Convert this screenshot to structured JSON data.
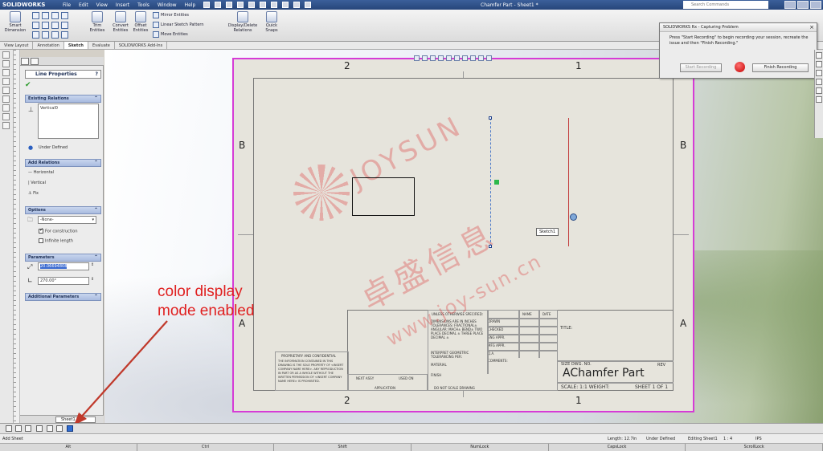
{
  "app": {
    "logo": "SOLIDWORKS",
    "menu": [
      "File",
      "Edit",
      "View",
      "Insert",
      "Tools",
      "Window",
      "Help"
    ],
    "doc_title": "Chamfer Part - Sheet1 *",
    "search_placeholder": "Search Commands"
  },
  "commands": {
    "smart_dimension": "Smart Dimension",
    "trim_entities": "Trim Entities",
    "convert_entities": "Convert Entities",
    "offset_entities": "Offset Entities",
    "mirror_entities": "Mirror Entities",
    "linear_sketch_pattern": "Linear Sketch Pattern",
    "move_entities": "Move Entities",
    "display_delete_relations": "Display/Delete Relations",
    "quick_snaps": "Quick Snaps"
  },
  "tabs": [
    {
      "label": "View Layout"
    },
    {
      "label": "Annotation"
    },
    {
      "label": "Sketch"
    },
    {
      "label": "Evaluate"
    },
    {
      "label": "SOLIDWORKS Add-Ins"
    }
  ],
  "property_manager": {
    "title": "Line Properties",
    "existing_relations": {
      "header": "Existing Relations",
      "item": "Vertical0",
      "status": "Under Defined"
    },
    "add_relations": {
      "header": "Add Relations",
      "items": [
        "Horizontal",
        "Vertical",
        "Fix"
      ]
    },
    "options": {
      "header": "Options",
      "dropdown_value": "-None-",
      "for_construction": "For construction",
      "infinite_length": "Infinite length"
    },
    "parameters": {
      "header": "Parameters",
      "length": "20.06694808",
      "angle": "270.00°"
    },
    "additional": {
      "header": "Additional Parameters"
    }
  },
  "sheet": {
    "zone_top": [
      "2",
      "1"
    ],
    "zone_bottom": [
      "2",
      "1"
    ],
    "zone_left": [
      "B",
      "A"
    ],
    "zone_right": [
      "B",
      "A"
    ],
    "part_name": "Chamfer Part",
    "size_label": "SIZE DWG. NO.",
    "size_value": "A",
    "rev_label": "REV",
    "title_label": "TITLE:",
    "scale_label": "SCALE: 1:1  WEIGHT:",
    "sheet_label": "SHEET 1 OF 1",
    "unless": "UNLESS OTHERWISE SPECIFIED:",
    "name_hdr": "NAME",
    "date_hdr": "DATE",
    "drawn": "DRAWN",
    "checked": "CHECKED",
    "eng_appr": "ENG APPR.",
    "mfg_appr": "MFG APPR.",
    "qa": "Q.A.",
    "comments": "COMMENTS:",
    "dim_note": "DIMENSIONS ARE IN INCHES TOLERANCES: FRACTIONAL± ANGULAR: MACH± BEND± TWO PLACE DECIMAL ± THREE PLACE DECIMAL ±",
    "interpret": "INTERPRET GEOMETRIC TOLERANCING PER:",
    "material": "MATERIAL",
    "finish": "FINISH",
    "next_assy": "NEXT ASSY",
    "used_on": "USED ON",
    "application": "APPLICATION",
    "do_not_scale": "DO NOT SCALE DRAWING",
    "proprietary_head": "PROPRIETARY AND CONFIDENTIAL",
    "proprietary_text": "THE INFORMATION CONTAINED IN THIS DRAWING IS THE SOLE PROPERTY OF <INSERT COMPANY NAME HERE>. ANY REPRODUCTION IN PART OR AS A WHOLE WITHOUT THE WRITTEN PERMISSION OF <INSERT COMPANY NAME HERE> IS PROHIBITED."
  },
  "sketch": {
    "tooltip": "Sketch1"
  },
  "watermark": {
    "line1": "JOYSUN",
    "line2": "卓盛信息",
    "line3": "www.joy-sun.cn"
  },
  "annotation": {
    "line1": "color display",
    "line2": "mode enabled",
    "color": "#e02020"
  },
  "dialog": {
    "title": "SOLIDWORKS Rx - Capturing Problem",
    "message": "Press \"Start Recording\" to begin recording your session, recreate the issue and then \"Finish Recording.\"",
    "start_button": "Start Recording",
    "finish_button": "Finish Recording"
  },
  "bottom": {
    "sheet_tab": "Sheet1",
    "status_left": "Add Sheet",
    "length": "Length: 12.7in",
    "defined": "Under Defined",
    "editing": "Editing Sheet1",
    "scale": "1 : 4",
    "units": "IPS",
    "keys": [
      "Alt",
      "Ctrl",
      "Shift",
      "NumLock",
      "CapsLock",
      "ScrollLock"
    ]
  },
  "colors": {
    "sheet_border": "#d63bd6",
    "selection_line": "#c23b3b",
    "centerline": "#4a78c8"
  }
}
